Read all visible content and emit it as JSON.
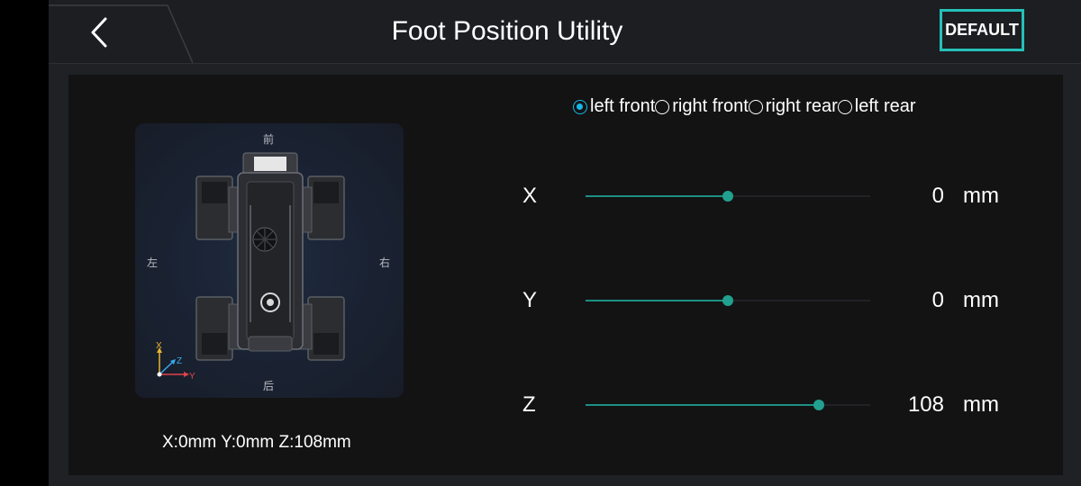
{
  "header": {
    "title": "Foot Position Utility",
    "default_label": "DEFAULT"
  },
  "robot_panel": {
    "directions": {
      "front": "前",
      "back": "后",
      "left": "左",
      "right": "右"
    },
    "axis_labels": {
      "x": "X",
      "y": "Y",
      "z": "Z"
    },
    "coordinates_text": "X:0mm Y:0mm Z:108mm"
  },
  "leg_selector": {
    "selected": 0,
    "options": [
      "left front",
      "right front",
      "right rear",
      "left rear"
    ]
  },
  "sliders": [
    {
      "axis": "X",
      "value": "0",
      "unit": "mm",
      "fraction": 0.5
    },
    {
      "axis": "Y",
      "value": "0",
      "unit": "mm",
      "fraction": 0.5
    },
    {
      "axis": "Z",
      "value": "108",
      "unit": "mm",
      "fraction": 0.82
    }
  ],
  "colors": {
    "accent": "#26c0b8",
    "slider": "#1e8f84",
    "radio": "#18b7e6"
  }
}
